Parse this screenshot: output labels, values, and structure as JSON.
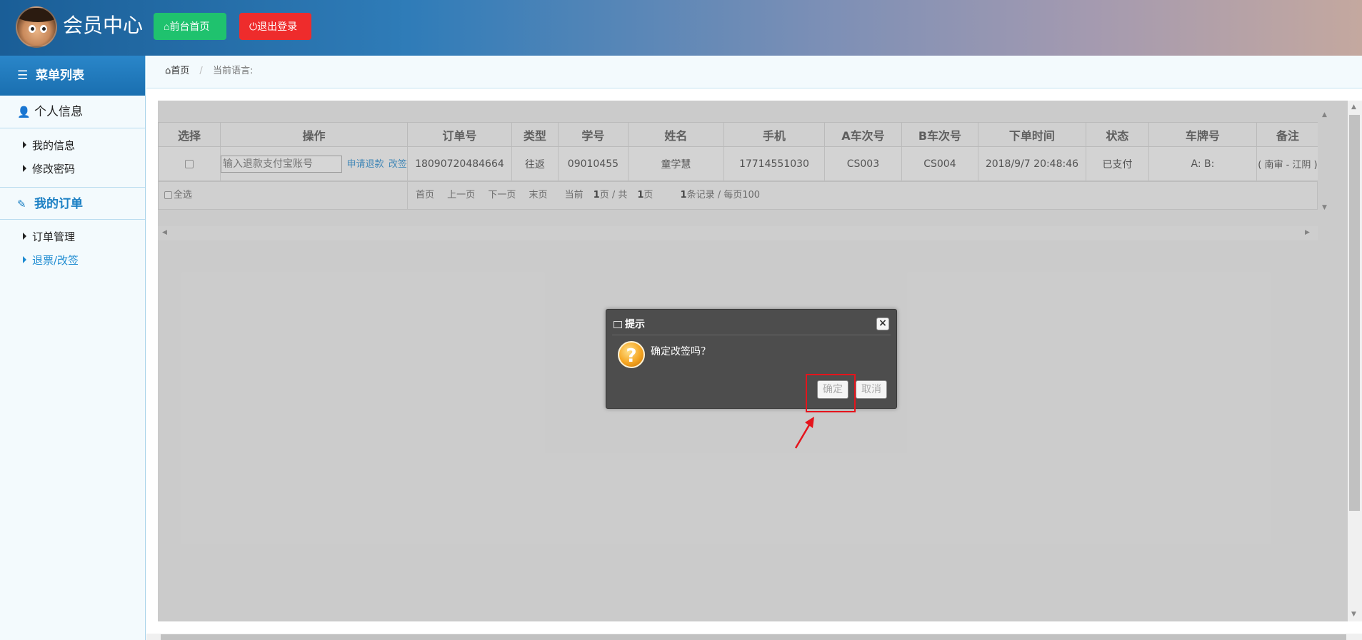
{
  "header": {
    "title": "会员中心",
    "home_btn": "前台首页",
    "logout_btn": "退出登录"
  },
  "sidebar": {
    "menu_title": "菜单列表",
    "groups": [
      {
        "label": "个人信息",
        "items": [
          "我的信息",
          "修改密码"
        ]
      },
      {
        "label": "我的订单",
        "items": [
          "订单管理",
          "退票/改签"
        ]
      }
    ]
  },
  "breadcrumb": {
    "home": "首页",
    "current_label": "当前语言:"
  },
  "table": {
    "headers": [
      "选择",
      "操作",
      "订单号",
      "类型",
      "学号",
      "姓名",
      "手机",
      "A车次号",
      "B车次号",
      "下单时间",
      "状态",
      "车牌号",
      "备注"
    ],
    "row": {
      "input_placeholder": "输入退款支付宝账号",
      "action_refund": "申请退款",
      "action_change": "改签",
      "order_no": "18090720484664",
      "type": "往返",
      "student_no": "09010455",
      "name": "童学慧",
      "phone": "17714551030",
      "train_a": "CS003",
      "train_b": "CS004",
      "order_time": "2018/9/7 20:48:46",
      "status": "已支付",
      "plate": "A: B:",
      "remark": "( 南审 - 江阴 )"
    },
    "footer": {
      "select_all": "全选",
      "first": "首页",
      "prev": "上一页",
      "next": "下一页",
      "last": "末页",
      "page_prefix": "当前",
      "page_current": "1",
      "page_mid": "页 / 共",
      "page_total": "1",
      "page_suffix": "页",
      "records_count": "1",
      "records_text": "条记录 / 每页100"
    }
  },
  "dialog": {
    "title": "提示",
    "message": "确定改签吗？",
    "ok": "确定",
    "cancel": "取消",
    "close": "×"
  },
  "colors": {
    "home_btn": "#1fc26e",
    "logout_btn": "#ee2c2c",
    "accent": "#1c80c4",
    "highlight": "#e5141c"
  }
}
